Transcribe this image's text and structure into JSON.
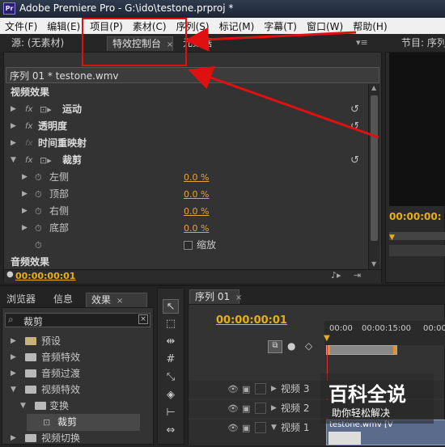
{
  "window": {
    "title": "Adobe Premiere Pro - G:\\ido\\testone.prproj *",
    "icon": "Pr"
  },
  "menu": [
    "文件(F)",
    "编辑(E)",
    "项目(P)",
    "素材(C)",
    "序列(S)",
    "标记(M)",
    "字幕(T)",
    "窗口(W)",
    "帮助(H)"
  ],
  "tabs": {
    "source": "源: (无素材)",
    "effect_controls": "特效控制台",
    "metadata": "元数据",
    "program": "节目: 序列"
  },
  "effect_controls": {
    "header": "序列 01 * testone.wmv",
    "video_effects": "视频效果",
    "items": [
      {
        "name": "运动"
      },
      {
        "name": "透明度"
      },
      {
        "name": "时间重映射"
      },
      {
        "name": "裁剪"
      }
    ],
    "params": [
      {
        "name": "左侧",
        "value": "0.0 %"
      },
      {
        "name": "顶部",
        "value": "0.0 %"
      },
      {
        "name": "右侧",
        "value": "0.0 %"
      },
      {
        "name": "底部",
        "value": "0.0 %"
      }
    ],
    "zoom_label": "缩放",
    "audio_effects": "音频效果",
    "timecode": "00:00:00:01"
  },
  "program": {
    "timecode": "00:00:00:"
  },
  "bottom_tabs": {
    "browser": "浏览器",
    "info": "信息",
    "effects": "效果"
  },
  "effects_panel": {
    "search": "裁剪",
    "tree": [
      {
        "label": "预设",
        "level": 0
      },
      {
        "label": "音频特效",
        "level": 0
      },
      {
        "label": "音频过渡",
        "level": 0
      },
      {
        "label": "视频特效",
        "level": 0
      },
      {
        "label": "变换",
        "level": 1
      },
      {
        "label": "裁剪",
        "level": 2
      },
      {
        "label": "视频切换",
        "level": 0
      }
    ]
  },
  "sequence": {
    "tab": "序列 01",
    "timecode": "00:00:00:01",
    "ruler": [
      "00:00",
      "00:00:15:00",
      "00:00"
    ],
    "tracks": [
      "视频 3",
      "视频 2",
      "视频 1"
    ],
    "clip": "testone.wmv [V"
  },
  "watermark": {
    "title": "百科全说",
    "subtitle": "助你轻松解决"
  }
}
